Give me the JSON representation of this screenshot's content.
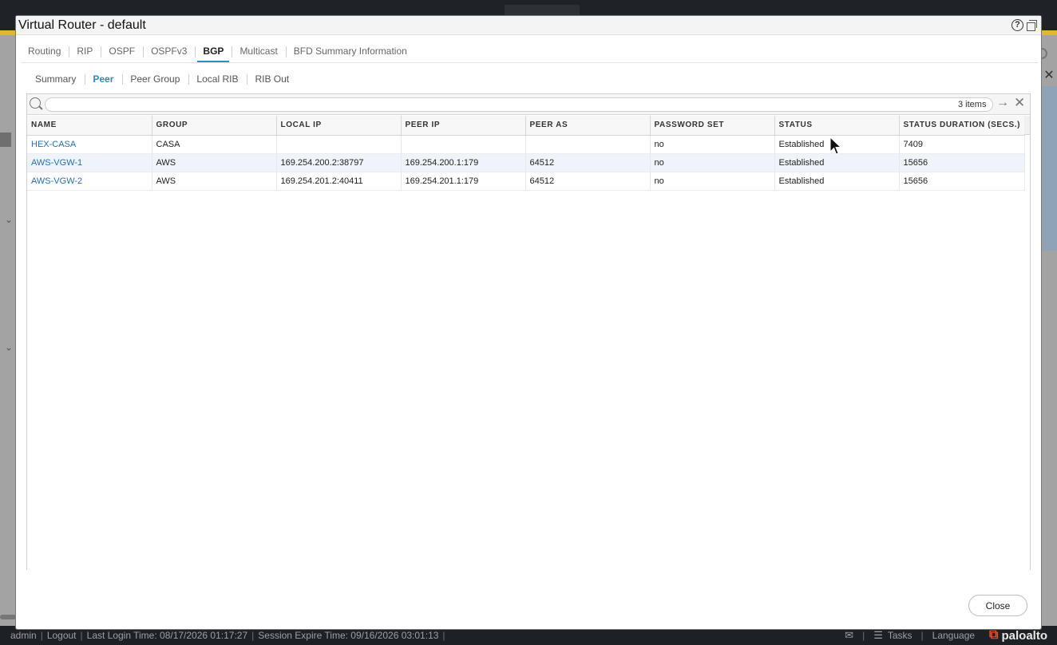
{
  "modal": {
    "title": "Virtual Router - default",
    "help_glyph": "?"
  },
  "tabs": [
    {
      "label": "Routing"
    },
    {
      "label": "RIP"
    },
    {
      "label": "OSPF"
    },
    {
      "label": "OSPFv3"
    },
    {
      "label": "BGP",
      "active": true
    },
    {
      "label": "Multicast"
    },
    {
      "label": "BFD Summary Information"
    }
  ],
  "subtabs": [
    {
      "label": "Summary"
    },
    {
      "label": "Peer",
      "active": true
    },
    {
      "label": "Peer Group"
    },
    {
      "label": "Local RIB"
    },
    {
      "label": "RIB Out"
    }
  ],
  "search": {
    "value": "",
    "placeholder": "",
    "items_count": "3 items"
  },
  "table": {
    "columns": [
      "NAME",
      "GROUP",
      "LOCAL IP",
      "PEER IP",
      "PEER AS",
      "PASSWORD SET",
      "STATUS",
      "STATUS DURATION (SECS.)"
    ],
    "rows": [
      [
        "HEX-CASA",
        "CASA",
        "",
        "",
        "",
        "no",
        "Established",
        "7409"
      ],
      [
        "AWS-VGW-1",
        "AWS",
        "169.254.200.2:38797",
        "169.254.200.1:179",
        "64512",
        "no",
        "Established",
        "15656"
      ],
      [
        "AWS-VGW-2",
        "AWS",
        "169.254.201.2:40411",
        "169.254.201.1:179",
        "64512",
        "no",
        "Established",
        "15656"
      ]
    ]
  },
  "buttons": {
    "close_label": "Close"
  },
  "footer": {
    "user": "admin",
    "logout": "Logout",
    "last_login": "Last Login Time: 08/17/2026 01:17:27",
    "session_expire": "Session Expire Time: 09/16/2026 03:01:13",
    "tasks": "Tasks",
    "language": "Language",
    "brand": "paloalto"
  },
  "colors": {
    "accent": "#2a8fbd",
    "link": "#2a6fa8",
    "header_bar": "#1f2327",
    "yellow_band": "#e0b92b"
  }
}
